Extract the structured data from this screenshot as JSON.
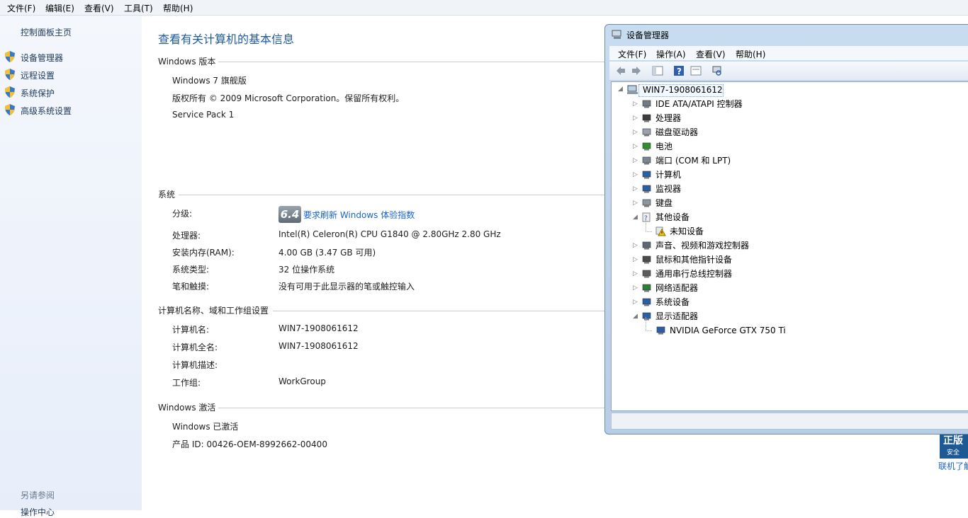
{
  "menubar": [
    "文件(F)",
    "编辑(E)",
    "查看(V)",
    "工具(T)",
    "帮助(H)"
  ],
  "left_pane": {
    "home_link": "控制面板主页",
    "tasks": [
      "设备管理器",
      "远程设置",
      "系统保护",
      "高级系统设置"
    ],
    "see_also_header": "另请参阅",
    "see_also_partial": "操作中心"
  },
  "main": {
    "title": "查看有关计算机的基本信息",
    "edition": {
      "header": "Windows 版本",
      "name": "Windows 7 旗舰版",
      "copyright": "版权所有 © 2009 Microsoft Corporation。保留所有权利。",
      "service_pack": "Service Pack 1"
    },
    "system": {
      "header": "系统",
      "rating_label": "分级:",
      "rating_badge": "6.4",
      "rating_link": "要求刷新 Windows 体验指数",
      "rows": [
        {
          "label": "处理器:",
          "value": "Intel(R) Celeron(R) CPU G1840 @ 2.80GHz   2.80 GHz"
        },
        {
          "label": "安装内存(RAM):",
          "value": "4.00 GB (3.47 GB 可用)"
        },
        {
          "label": "系统类型:",
          "value": "32 位操作系统"
        },
        {
          "label": "笔和触摸:",
          "value": "没有可用于此显示器的笔或触控输入"
        }
      ]
    },
    "computer": {
      "header": "计算机名称、域和工作组设置",
      "rows": [
        {
          "label": "计算机名:",
          "value": "WIN7-1908061612"
        },
        {
          "label": "计算机全名:",
          "value": "WIN7-1908061612"
        },
        {
          "label": "计算机描述:",
          "value": ""
        },
        {
          "label": "工作组:",
          "value": "WorkGroup"
        }
      ]
    },
    "activation": {
      "header": "Windows 激活",
      "status": "Windows 已激活",
      "product_id": "产品 ID: 00426-OEM-8992662-00400"
    }
  },
  "device_manager": {
    "title": "设备管理器",
    "menu": [
      "文件(F)",
      "操作(A)",
      "查看(V)",
      "帮助(H)"
    ],
    "root": "WIN7-1908061612",
    "nodes": [
      {
        "label": "IDE ATA/ATAPI 控制器",
        "icon": "ide-controller-icon",
        "expanded": false
      },
      {
        "label": "处理器",
        "icon": "processor-icon",
        "expanded": false
      },
      {
        "label": "磁盘驱动器",
        "icon": "disk-drive-icon",
        "expanded": false
      },
      {
        "label": "电池",
        "icon": "battery-icon",
        "expanded": false
      },
      {
        "label": "端口 (COM 和 LPT)",
        "icon": "port-icon",
        "expanded": false
      },
      {
        "label": "计算机",
        "icon": "computer-icon",
        "expanded": false
      },
      {
        "label": "监视器",
        "icon": "monitor-icon",
        "expanded": false
      },
      {
        "label": "键盘",
        "icon": "keyboard-icon",
        "expanded": false
      },
      {
        "label": "其他设备",
        "icon": "other-devices-icon",
        "expanded": true
      },
      {
        "label": "未知设备",
        "icon": "unknown-device-warning-icon",
        "child": true
      },
      {
        "label": "声音、视频和游戏控制器",
        "icon": "sound-icon",
        "expanded": false
      },
      {
        "label": "鼠标和其他指针设备",
        "icon": "mouse-icon",
        "expanded": false
      },
      {
        "label": "通用串行总线控制器",
        "icon": "usb-icon",
        "expanded": false
      },
      {
        "label": "网络适配器",
        "icon": "network-adapter-icon",
        "expanded": false
      },
      {
        "label": "系统设备",
        "icon": "system-device-icon",
        "expanded": false
      },
      {
        "label": "显示适配器",
        "icon": "display-adapter-icon",
        "expanded": true
      },
      {
        "label": "NVIDIA GeForce GTX 750 Ti",
        "icon": "gpu-icon",
        "child": true
      }
    ]
  },
  "genuine": {
    "line1": "正版",
    "line2": "安全",
    "link": "联机了解"
  }
}
